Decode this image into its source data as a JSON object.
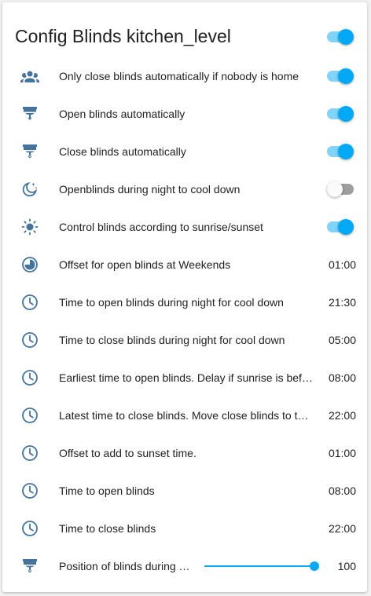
{
  "card": {
    "title": "Config Blinds kitchen_level",
    "master_toggle_on": true
  },
  "colors": {
    "accent": "#03a9f4",
    "icon": "#44739e"
  },
  "rows": [
    {
      "icon": "account-group-icon",
      "label": "Only close blinds automatically if nobody is home",
      "type": "toggle",
      "on": true
    },
    {
      "icon": "blinds-open-icon",
      "label": "Open blinds automatically",
      "type": "toggle",
      "on": true
    },
    {
      "icon": "blinds-close-icon",
      "label": "Close blinds automatically",
      "type": "toggle",
      "on": true
    },
    {
      "icon": "weather-night-icon",
      "label": "Openblinds during night to cool down",
      "type": "toggle",
      "on": false
    },
    {
      "icon": "sun-icon",
      "label": "Control blinds according to sunrise/sunset",
      "type": "toggle",
      "on": true
    },
    {
      "icon": "clock-circle-icon",
      "label": "Offset for open blinds at Weekends",
      "type": "value",
      "value": "01:00"
    },
    {
      "icon": "clock-icon",
      "label": "Time to open blinds during night for cool down",
      "type": "value",
      "value": "21:30"
    },
    {
      "icon": "clock-icon",
      "label": "Time to close blinds during night for cool down",
      "type": "value",
      "value": "05:00"
    },
    {
      "icon": "clock-icon",
      "label": "Earliest time to open blinds. Delay if sunrise is before this time",
      "type": "value",
      "value": "08:00"
    },
    {
      "icon": "clock-icon",
      "label": "Latest time to close blinds. Move close blinds to this time",
      "type": "value",
      "value": "22:00"
    },
    {
      "icon": "clock-icon",
      "label": "Offset to add to sunset time.",
      "type": "value",
      "value": "01:00"
    },
    {
      "icon": "clock-icon",
      "label": "Time to open blinds",
      "type": "value",
      "value": "08:00"
    },
    {
      "icon": "clock-icon",
      "label": "Time to close blinds",
      "type": "value",
      "value": "22:00"
    },
    {
      "icon": "blinds-icon",
      "label": "Position of blinds during night",
      "type": "slider",
      "value": "100",
      "slider_fraction": 1.0
    }
  ]
}
